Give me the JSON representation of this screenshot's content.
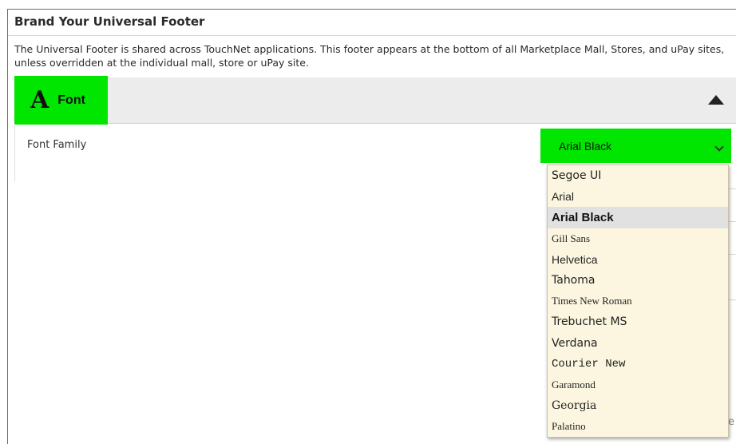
{
  "page": {
    "title": "Brand Your Universal Footer",
    "description": "The Universal Footer is shared across TouchNet applications. This footer appears at the bottom of all Marketplace Mall, Stores, and uPay sites, unless overridden at the individual mall, store or uPay site."
  },
  "font_panel": {
    "icon": "A",
    "icon_name": "font-letter-icon",
    "label": "Font",
    "expanded": true,
    "accent_color": "#00e600"
  },
  "font_family": {
    "label": "Font Family",
    "selected": "Arial Black",
    "options": [
      "Segoe UI",
      "Arial",
      "Arial Black",
      "Gill Sans",
      "Helvetica",
      "Tahoma",
      "Times New Roman",
      "Trebuchet MS",
      "Verdana",
      "Courier New",
      "Garamond",
      "Georgia",
      "Palatino"
    ],
    "dropdown_bg": "#fcf6e0",
    "selected_bg": "#e1e1e1"
  }
}
